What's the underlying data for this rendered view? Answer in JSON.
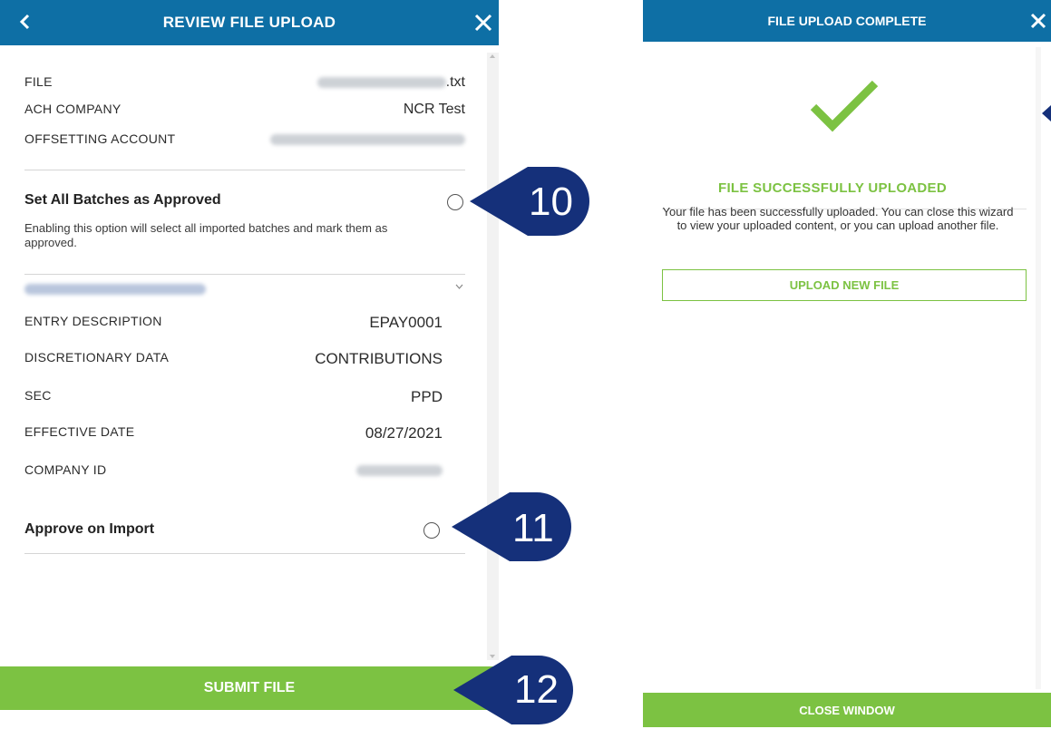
{
  "review": {
    "title": "REVIEW FILE UPLOAD",
    "file_label": "FILE",
    "file_suffix": ".txt",
    "ach_label": "ACH COMPANY",
    "ach_value": "NCR Test",
    "offset_label": "OFFSETTING ACCOUNT",
    "set_all_title": "Set All Batches as Approved",
    "set_all_desc": "Enabling this option will select all imported batches and mark them as approved.",
    "entry_label": "ENTRY DESCRIPTION",
    "entry_value": "EPAY0001",
    "disc_label": "DISCRETIONARY DATA",
    "disc_value": "CONTRIBUTIONS",
    "sec_label": "SEC",
    "sec_value": "PPD",
    "eff_label": "EFFECTIVE DATE",
    "eff_value": "08/27/2021",
    "company_id_label": "COMPANY ID",
    "approve_title": "Approve on Import",
    "submit_label": "SUBMIT FILE"
  },
  "callouts": [
    "10",
    "11",
    "12"
  ],
  "complete": {
    "title": "FILE UPLOAD COMPLETE",
    "success_title": "FILE SUCCESSFULLY UPLOADED",
    "message": "Your file has been successfully uploaded. You can close this wizard to view your uploaded content, or you can upload another file.",
    "upload_new_label": "UPLOAD NEW FILE",
    "close_window_label": "CLOSE WINDOW"
  },
  "colors": {
    "header_blue": "#0e6fa5",
    "accent_green": "#7cc242",
    "callout_navy": "#15307a"
  },
  "icons": [
    "chevron-left-icon",
    "close-icon",
    "checkmark-icon",
    "chevron-down-icon"
  ]
}
